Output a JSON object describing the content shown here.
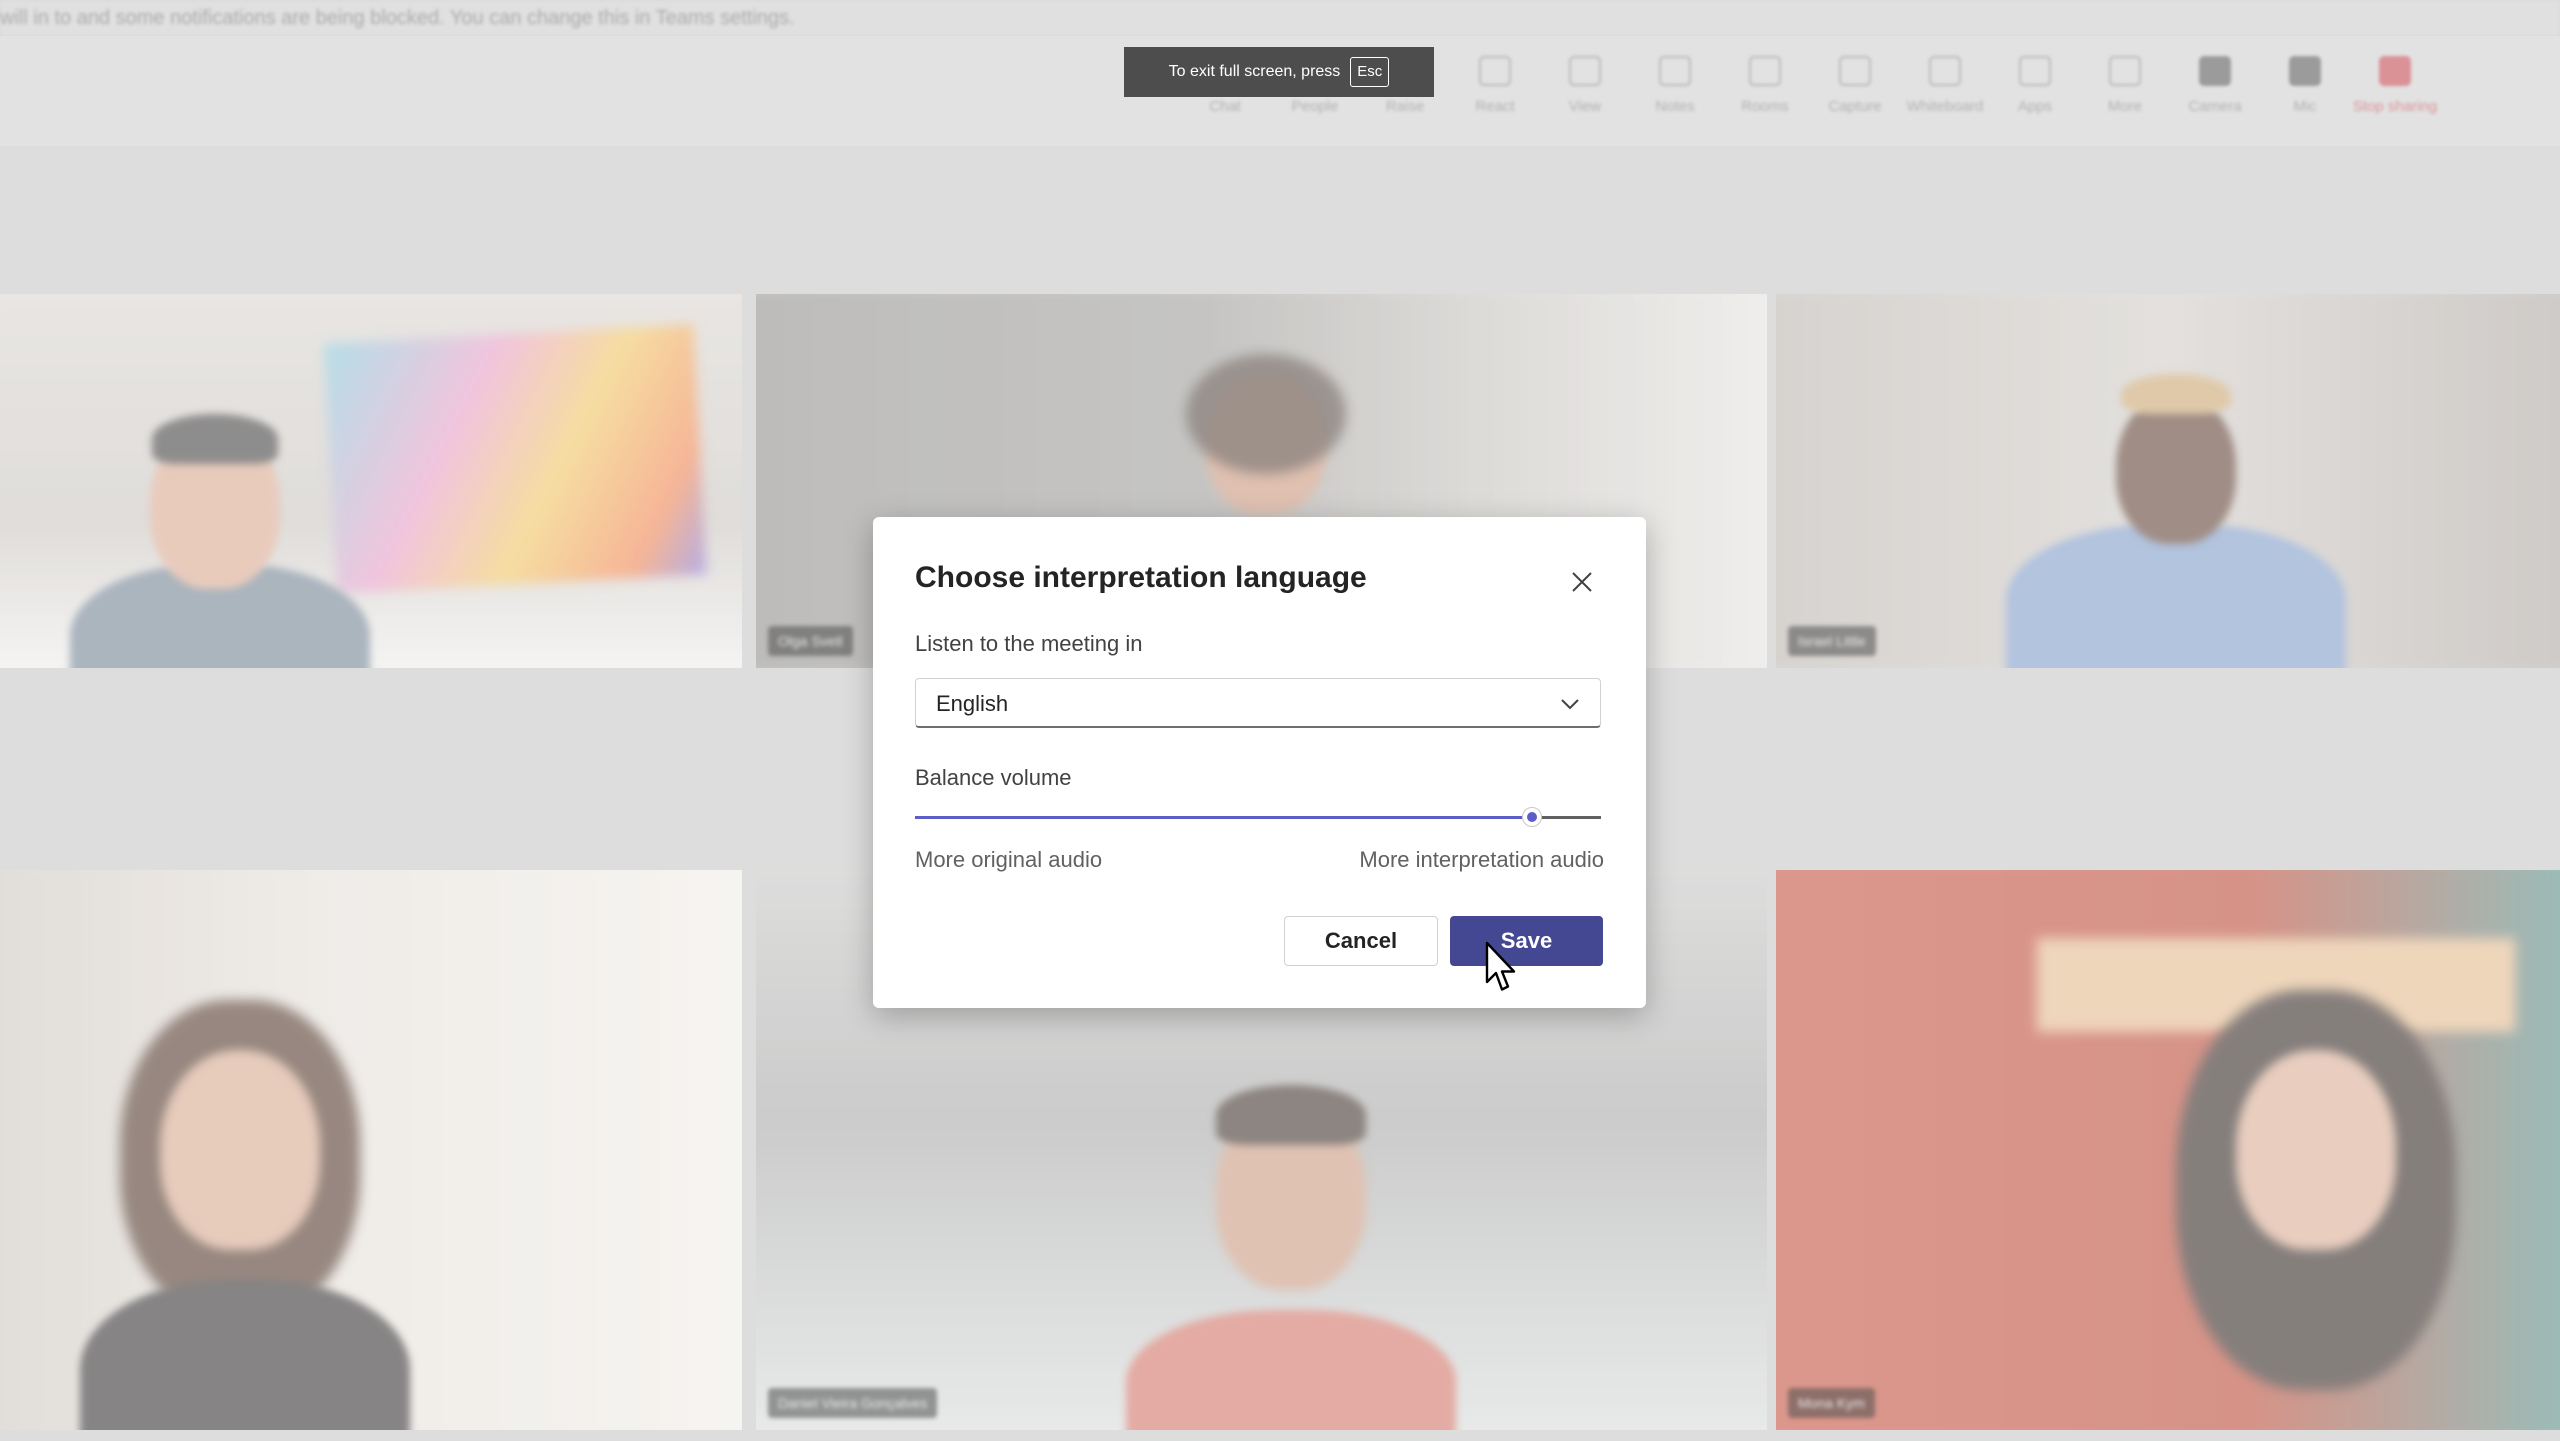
{
  "notice_bar": {
    "text": "will in to and some notifications are being blocked. You can change this in Teams settings."
  },
  "fullscreen_hint": {
    "text": "To exit full screen, press",
    "key": "Esc"
  },
  "toolbar": {
    "items": [
      {
        "label": "Chat",
        "icon": "chat-icon"
      },
      {
        "label": "People",
        "icon": "people-icon"
      },
      {
        "label": "Raise",
        "icon": "raise-hand-icon"
      },
      {
        "label": "React",
        "icon": "react-icon"
      },
      {
        "label": "View",
        "icon": "view-icon"
      },
      {
        "label": "Notes",
        "icon": "notes-icon"
      },
      {
        "label": "Rooms",
        "icon": "rooms-icon"
      },
      {
        "label": "Capture",
        "icon": "capture-icon"
      },
      {
        "label": "Whiteboard",
        "icon": "whiteboard-icon"
      },
      {
        "label": "Apps",
        "icon": "apps-icon"
      },
      {
        "label": "More",
        "icon": "more-icon"
      },
      {
        "label": "Camera",
        "icon": "camera-icon"
      },
      {
        "label": "Mic",
        "icon": "mic-icon"
      },
      {
        "label": "Stop sharing",
        "icon": "stop-sharing-icon"
      }
    ]
  },
  "participants": [
    {
      "name": ""
    },
    {
      "name": "Olga Svetl"
    },
    {
      "name": "Israel Little"
    },
    {
      "name": ""
    },
    {
      "name": "Daniel Vieira Gonçalves"
    },
    {
      "name": "Mona Kym"
    }
  ],
  "dialog": {
    "title": "Choose interpretation language",
    "listen_label": "Listen to the meeting in",
    "language_value": "English",
    "balance_label": "Balance volume",
    "balance_value": 0.9,
    "left_hint": "More original audio",
    "right_hint": "More interpretation audio",
    "cancel_label": "Cancel",
    "save_label": "Save"
  },
  "colors": {
    "primary": "#444791",
    "slider_accent": "#5b5fc7",
    "stop_sharing": "#d05a63"
  }
}
